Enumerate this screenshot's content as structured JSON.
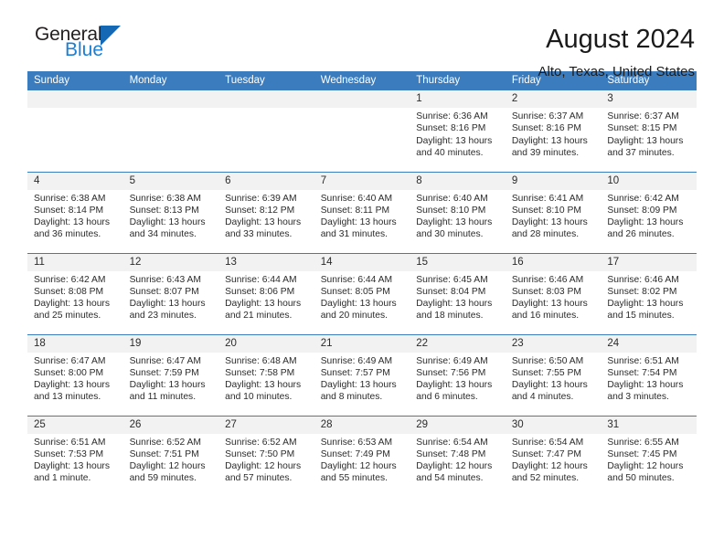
{
  "brand": {
    "name_part1": "General",
    "name_part2": "Blue"
  },
  "header": {
    "title": "August 2024",
    "location": "Alto, Texas, United States"
  },
  "colors": {
    "header_blue": "#3b7cbf",
    "band_gray": "#f2f2f2",
    "logo_blue": "#1b7fd4",
    "text": "#2b2b2b"
  },
  "weekday_headers": [
    "Sunday",
    "Monday",
    "Tuesday",
    "Wednesday",
    "Thursday",
    "Friday",
    "Saturday"
  ],
  "weeks": [
    [
      {
        "day": "",
        "sunrise": "",
        "sunset": "",
        "daylight1": "",
        "daylight2": ""
      },
      {
        "day": "",
        "sunrise": "",
        "sunset": "",
        "daylight1": "",
        "daylight2": ""
      },
      {
        "day": "",
        "sunrise": "",
        "sunset": "",
        "daylight1": "",
        "daylight2": ""
      },
      {
        "day": "",
        "sunrise": "",
        "sunset": "",
        "daylight1": "",
        "daylight2": ""
      },
      {
        "day": "1",
        "sunrise": "Sunrise: 6:36 AM",
        "sunset": "Sunset: 8:16 PM",
        "daylight1": "Daylight: 13 hours",
        "daylight2": "and 40 minutes."
      },
      {
        "day": "2",
        "sunrise": "Sunrise: 6:37 AM",
        "sunset": "Sunset: 8:16 PM",
        "daylight1": "Daylight: 13 hours",
        "daylight2": "and 39 minutes."
      },
      {
        "day": "3",
        "sunrise": "Sunrise: 6:37 AM",
        "sunset": "Sunset: 8:15 PM",
        "daylight1": "Daylight: 13 hours",
        "daylight2": "and 37 minutes."
      }
    ],
    [
      {
        "day": "4",
        "sunrise": "Sunrise: 6:38 AM",
        "sunset": "Sunset: 8:14 PM",
        "daylight1": "Daylight: 13 hours",
        "daylight2": "and 36 minutes."
      },
      {
        "day": "5",
        "sunrise": "Sunrise: 6:38 AM",
        "sunset": "Sunset: 8:13 PM",
        "daylight1": "Daylight: 13 hours",
        "daylight2": "and 34 minutes."
      },
      {
        "day": "6",
        "sunrise": "Sunrise: 6:39 AM",
        "sunset": "Sunset: 8:12 PM",
        "daylight1": "Daylight: 13 hours",
        "daylight2": "and 33 minutes."
      },
      {
        "day": "7",
        "sunrise": "Sunrise: 6:40 AM",
        "sunset": "Sunset: 8:11 PM",
        "daylight1": "Daylight: 13 hours",
        "daylight2": "and 31 minutes."
      },
      {
        "day": "8",
        "sunrise": "Sunrise: 6:40 AM",
        "sunset": "Sunset: 8:10 PM",
        "daylight1": "Daylight: 13 hours",
        "daylight2": "and 30 minutes."
      },
      {
        "day": "9",
        "sunrise": "Sunrise: 6:41 AM",
        "sunset": "Sunset: 8:10 PM",
        "daylight1": "Daylight: 13 hours",
        "daylight2": "and 28 minutes."
      },
      {
        "day": "10",
        "sunrise": "Sunrise: 6:42 AM",
        "sunset": "Sunset: 8:09 PM",
        "daylight1": "Daylight: 13 hours",
        "daylight2": "and 26 minutes."
      }
    ],
    [
      {
        "day": "11",
        "sunrise": "Sunrise: 6:42 AM",
        "sunset": "Sunset: 8:08 PM",
        "daylight1": "Daylight: 13 hours",
        "daylight2": "and 25 minutes."
      },
      {
        "day": "12",
        "sunrise": "Sunrise: 6:43 AM",
        "sunset": "Sunset: 8:07 PM",
        "daylight1": "Daylight: 13 hours",
        "daylight2": "and 23 minutes."
      },
      {
        "day": "13",
        "sunrise": "Sunrise: 6:44 AM",
        "sunset": "Sunset: 8:06 PM",
        "daylight1": "Daylight: 13 hours",
        "daylight2": "and 21 minutes."
      },
      {
        "day": "14",
        "sunrise": "Sunrise: 6:44 AM",
        "sunset": "Sunset: 8:05 PM",
        "daylight1": "Daylight: 13 hours",
        "daylight2": "and 20 minutes."
      },
      {
        "day": "15",
        "sunrise": "Sunrise: 6:45 AM",
        "sunset": "Sunset: 8:04 PM",
        "daylight1": "Daylight: 13 hours",
        "daylight2": "and 18 minutes."
      },
      {
        "day": "16",
        "sunrise": "Sunrise: 6:46 AM",
        "sunset": "Sunset: 8:03 PM",
        "daylight1": "Daylight: 13 hours",
        "daylight2": "and 16 minutes."
      },
      {
        "day": "17",
        "sunrise": "Sunrise: 6:46 AM",
        "sunset": "Sunset: 8:02 PM",
        "daylight1": "Daylight: 13 hours",
        "daylight2": "and 15 minutes."
      }
    ],
    [
      {
        "day": "18",
        "sunrise": "Sunrise: 6:47 AM",
        "sunset": "Sunset: 8:00 PM",
        "daylight1": "Daylight: 13 hours",
        "daylight2": "and 13 minutes."
      },
      {
        "day": "19",
        "sunrise": "Sunrise: 6:47 AM",
        "sunset": "Sunset: 7:59 PM",
        "daylight1": "Daylight: 13 hours",
        "daylight2": "and 11 minutes."
      },
      {
        "day": "20",
        "sunrise": "Sunrise: 6:48 AM",
        "sunset": "Sunset: 7:58 PM",
        "daylight1": "Daylight: 13 hours",
        "daylight2": "and 10 minutes."
      },
      {
        "day": "21",
        "sunrise": "Sunrise: 6:49 AM",
        "sunset": "Sunset: 7:57 PM",
        "daylight1": "Daylight: 13 hours",
        "daylight2": "and 8 minutes."
      },
      {
        "day": "22",
        "sunrise": "Sunrise: 6:49 AM",
        "sunset": "Sunset: 7:56 PM",
        "daylight1": "Daylight: 13 hours",
        "daylight2": "and 6 minutes."
      },
      {
        "day": "23",
        "sunrise": "Sunrise: 6:50 AM",
        "sunset": "Sunset: 7:55 PM",
        "daylight1": "Daylight: 13 hours",
        "daylight2": "and 4 minutes."
      },
      {
        "day": "24",
        "sunrise": "Sunrise: 6:51 AM",
        "sunset": "Sunset: 7:54 PM",
        "daylight1": "Daylight: 13 hours",
        "daylight2": "and 3 minutes."
      }
    ],
    [
      {
        "day": "25",
        "sunrise": "Sunrise: 6:51 AM",
        "sunset": "Sunset: 7:53 PM",
        "daylight1": "Daylight: 13 hours",
        "daylight2": "and 1 minute."
      },
      {
        "day": "26",
        "sunrise": "Sunrise: 6:52 AM",
        "sunset": "Sunset: 7:51 PM",
        "daylight1": "Daylight: 12 hours",
        "daylight2": "and 59 minutes."
      },
      {
        "day": "27",
        "sunrise": "Sunrise: 6:52 AM",
        "sunset": "Sunset: 7:50 PM",
        "daylight1": "Daylight: 12 hours",
        "daylight2": "and 57 minutes."
      },
      {
        "day": "28",
        "sunrise": "Sunrise: 6:53 AM",
        "sunset": "Sunset: 7:49 PM",
        "daylight1": "Daylight: 12 hours",
        "daylight2": "and 55 minutes."
      },
      {
        "day": "29",
        "sunrise": "Sunrise: 6:54 AM",
        "sunset": "Sunset: 7:48 PM",
        "daylight1": "Daylight: 12 hours",
        "daylight2": "and 54 minutes."
      },
      {
        "day": "30",
        "sunrise": "Sunrise: 6:54 AM",
        "sunset": "Sunset: 7:47 PM",
        "daylight1": "Daylight: 12 hours",
        "daylight2": "and 52 minutes."
      },
      {
        "day": "31",
        "sunrise": "Sunrise: 6:55 AM",
        "sunset": "Sunset: 7:45 PM",
        "daylight1": "Daylight: 12 hours",
        "daylight2": "and 50 minutes."
      }
    ]
  ]
}
